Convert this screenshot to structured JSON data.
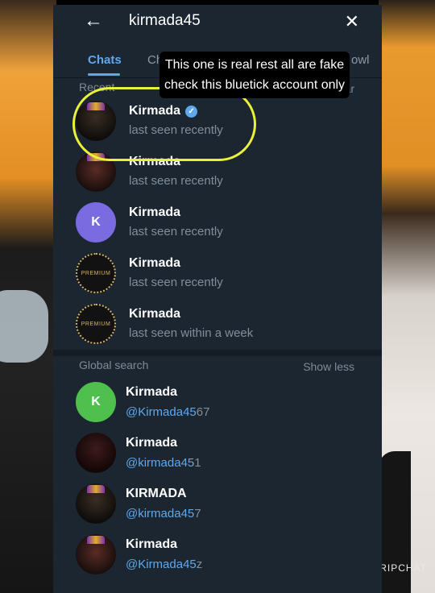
{
  "search": {
    "query": "kirmada45"
  },
  "tabs": [
    "Chats",
    "Ch",
    "owl"
  ],
  "recent": {
    "title": "Recent",
    "action": "Clear",
    "items": [
      {
        "name": "Kirmada",
        "status": "last seen recently",
        "verified": true,
        "avatar": "character"
      },
      {
        "name": "Kirmada",
        "status": "last seen recently",
        "verified": false,
        "avatar": "character"
      },
      {
        "name": "Kirmada",
        "status": "last seen recently",
        "verified": false,
        "avatar": "K"
      },
      {
        "name": "Kirmada",
        "status": "last seen recently",
        "verified": false,
        "avatar": "premium"
      },
      {
        "name": "Kirmada",
        "status": "last seen within a week",
        "verified": false,
        "avatar": "premium"
      }
    ]
  },
  "global": {
    "title": "Global search",
    "action": "Show less",
    "items": [
      {
        "name": "Kirmada",
        "handle": "@Kirmada45",
        "handle_rest": "67",
        "avatar": "K"
      },
      {
        "name": "Kirmada",
        "handle": "@kirmada45",
        "handle_rest": "1",
        "avatar": "dark"
      },
      {
        "name": "KIRMADA",
        "handle": "@kirmada45",
        "handle_rest": "7",
        "avatar": "character"
      },
      {
        "name": "Kirmada",
        "handle": "@Kirmada45",
        "handle_rest": "z",
        "avatar": "character"
      }
    ]
  },
  "premium_label": "PREMIUM",
  "annotation": {
    "line1": "This one is real rest all are fake",
    "line2": "check this  bluetick account only"
  },
  "watermark": "RIPCHAT",
  "colors": {
    "accent": "#5fa8ee",
    "highlight": "#eaf13a",
    "panel": "#1b2631"
  }
}
